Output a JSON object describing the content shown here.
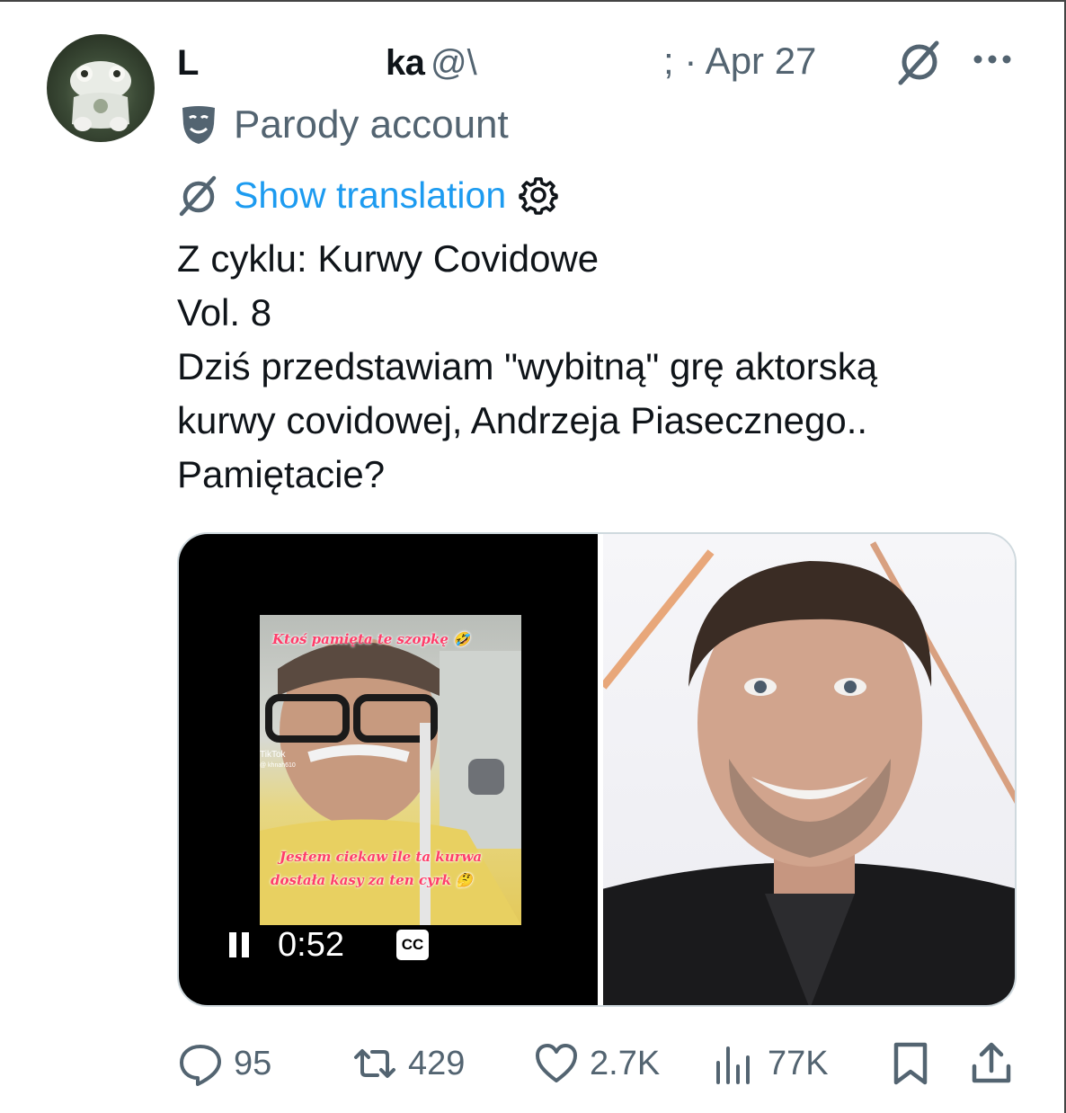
{
  "post": {
    "author_name_start": "L",
    "author_name_end": "ka",
    "handle": "@\\",
    "date": "; · Apr 27",
    "parody_label": "Parody account",
    "show_translation": "Show translation",
    "lines": [
      "Z cyklu: Kurwy Covidowe",
      "Vol. 8",
      "Dziś przedstawiam \"wybitną\" grę aktorską",
      "kurwy covidowej, Andrzeja Piasecznego..",
      "Pamiętacie?"
    ]
  },
  "video": {
    "caption_top": "Ktoś pamięta te szopkę 🤣",
    "caption_bottom_1": "Jestem ciekaw ile ta kurwa",
    "caption_bottom_2": "dostała kasy za ten cyrk 🤔",
    "tiktok_label": "TikTok",
    "tiktok_user": "@ khnah610",
    "time": "0:52",
    "cc_label": "CC"
  },
  "actions": {
    "replies": "95",
    "reposts": "429",
    "likes": "2.7K",
    "views": "77K"
  },
  "icons": [
    "avatar",
    "grok-icon",
    "more-icon",
    "parody-mask-icon",
    "translate-icon",
    "settings-gear-icon",
    "pause-icon",
    "reply-icon",
    "repost-icon",
    "like-icon",
    "views-icon",
    "bookmark-icon",
    "share-icon"
  ],
  "colors": {
    "link": "#1d9bf0",
    "muted": "#536471",
    "text": "#0f1419"
  }
}
